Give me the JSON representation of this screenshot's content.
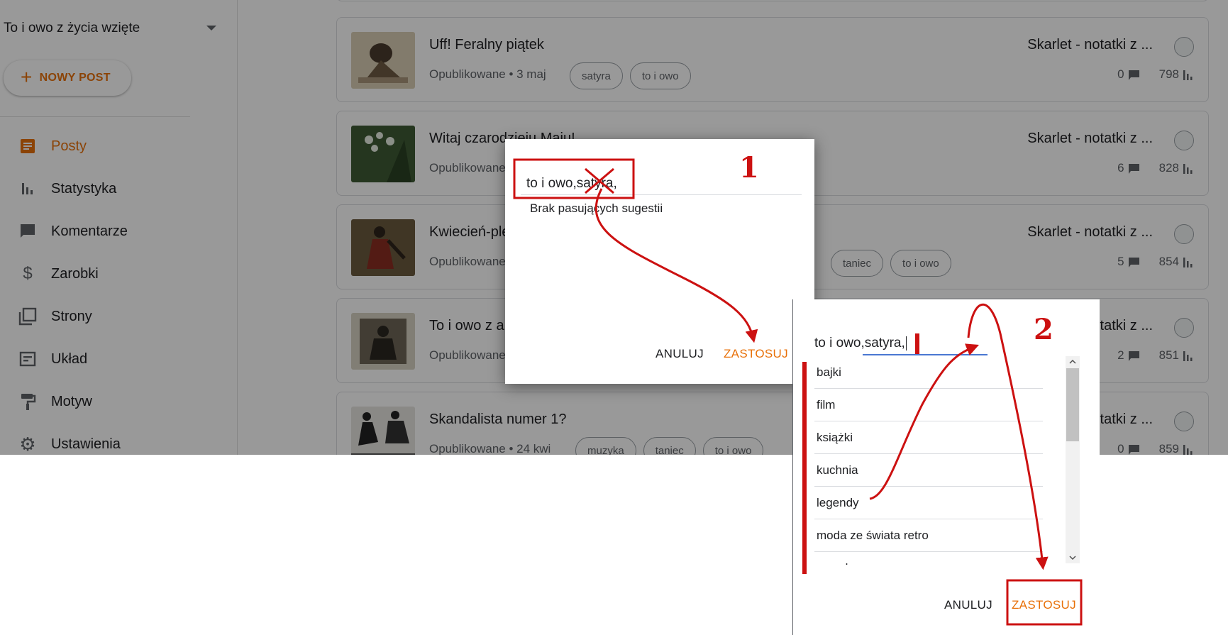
{
  "sidebar": {
    "blog_name": "To i owo z życia wzięte",
    "new_post_label": "NOWY POST",
    "items": [
      {
        "label": "Posty",
        "icon": "posts-icon"
      },
      {
        "label": "Statystyka",
        "icon": "stats-icon"
      },
      {
        "label": "Komentarze",
        "icon": "comment-icon"
      },
      {
        "label": "Zarobki",
        "icon": "dollar-icon"
      },
      {
        "label": "Strony",
        "icon": "pages-icon"
      },
      {
        "label": "Układ",
        "icon": "layout-icon"
      },
      {
        "label": "Motyw",
        "icon": "paint-roller-icon"
      },
      {
        "label": "Ustawienia",
        "icon": "gear-icon"
      }
    ],
    "active_item": "Posty"
  },
  "posts": [
    {
      "title": "Uff! Feralny piątek",
      "meta": "Opublikowane • 3 maj",
      "labels": [
        "satyra",
        "to i owo"
      ],
      "blog": "Skarlet - notatki z ...",
      "comments": "0",
      "views": "798"
    },
    {
      "title": "Witaj czarodzieju Maju!",
      "meta": "Opublikowane",
      "labels": [],
      "blog": "Skarlet - notatki z ...",
      "comments": "6",
      "views": "828"
    },
    {
      "title": "Kwiecień-plecień",
      "meta": "Opublikowane",
      "labels": [
        "taniec",
        "to i owo"
      ],
      "blog": "Skarlet - notatki z ...",
      "comments": "5",
      "views": "854"
    },
    {
      "title": "To i owo z a",
      "meta": "Opublikowane",
      "labels": [],
      "blog": "Skarlet - notatki z ...",
      "comments": "2",
      "views": "851"
    },
    {
      "title": "Skandalista numer 1?",
      "meta": "Opublikowane • 24 kwi",
      "labels": [
        "muzyka",
        "taniec",
        "to i owo"
      ],
      "blog": "Skarlet - notatki z ...",
      "comments": "0",
      "views": "859"
    }
  ],
  "dialog1": {
    "input_value": "to i owo,satyra,",
    "no_suggestions": "Brak pasujących sugestii",
    "cancel_label": "ANULUJ",
    "apply_label": "ZASTOSUJ"
  },
  "dialog2": {
    "input_value": "to i owo,satyra,",
    "suggestions": [
      "bajki",
      "film",
      "książki",
      "kuchnia",
      "legendy",
      "moda ze świata retro",
      "muzvka"
    ],
    "cancel_label": "ANULUJ",
    "apply_label": "ZASTOSUJ"
  },
  "annotations": {
    "step1": "1",
    "step2": "2",
    "color": "#cc1111"
  },
  "colors": {
    "accent": "#e8710a",
    "annotation_red": "#cc1111",
    "focus_blue": "#4a78d2"
  }
}
